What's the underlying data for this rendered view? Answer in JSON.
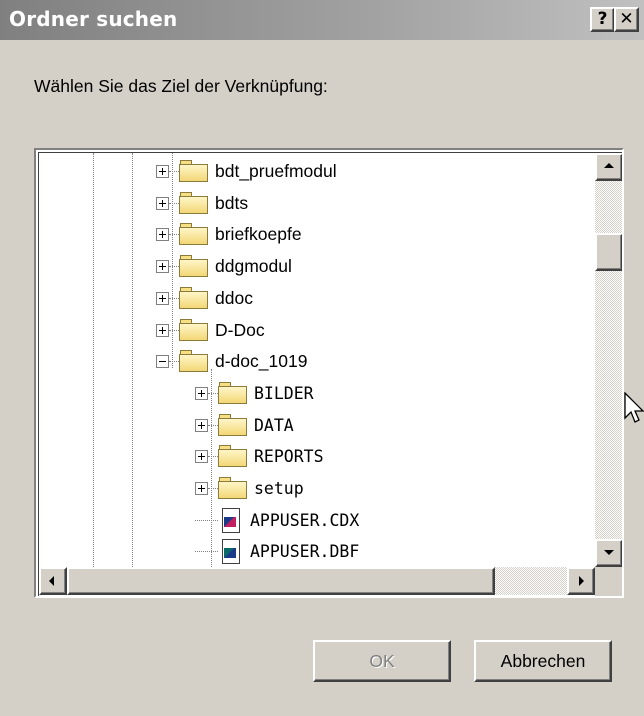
{
  "window": {
    "title": "Ordner suchen",
    "help_button": "?",
    "close_button": "✕"
  },
  "dialog": {
    "prompt": "Wählen Sie das Ziel der Verknüpfung:"
  },
  "tree": {
    "items": [
      {
        "label": "bdt_pruefmodul",
        "type": "folder",
        "expander": "+"
      },
      {
        "label": "bdts",
        "type": "folder",
        "expander": "+"
      },
      {
        "label": "briefkoepfe",
        "type": "folder",
        "expander": "+"
      },
      {
        "label": "ddgmodul",
        "type": "folder",
        "expander": "+"
      },
      {
        "label": "ddoc",
        "type": "folder",
        "expander": "+"
      },
      {
        "label": "D-Doc",
        "type": "folder",
        "expander": "+"
      },
      {
        "label": "d-doc_1019",
        "type": "folder",
        "expander": "-"
      },
      {
        "label": "BILDER",
        "type": "folder",
        "expander": "+"
      },
      {
        "label": "DATA",
        "type": "folder",
        "expander": "+"
      },
      {
        "label": "REPORTS",
        "type": "folder",
        "expander": "+"
      },
      {
        "label": "setup",
        "type": "folder",
        "expander": "+"
      },
      {
        "label": "APPUSER.CDX",
        "type": "file"
      },
      {
        "label": "APPUSER.DBF",
        "type": "file"
      }
    ]
  },
  "buttons": {
    "ok_label": "OK",
    "cancel_label": "Abbrechen"
  },
  "colors": {
    "dialog_bg": "#d4d0c8",
    "titlebar_inactive": "#808080",
    "folder_yellow": "#f3d777"
  }
}
